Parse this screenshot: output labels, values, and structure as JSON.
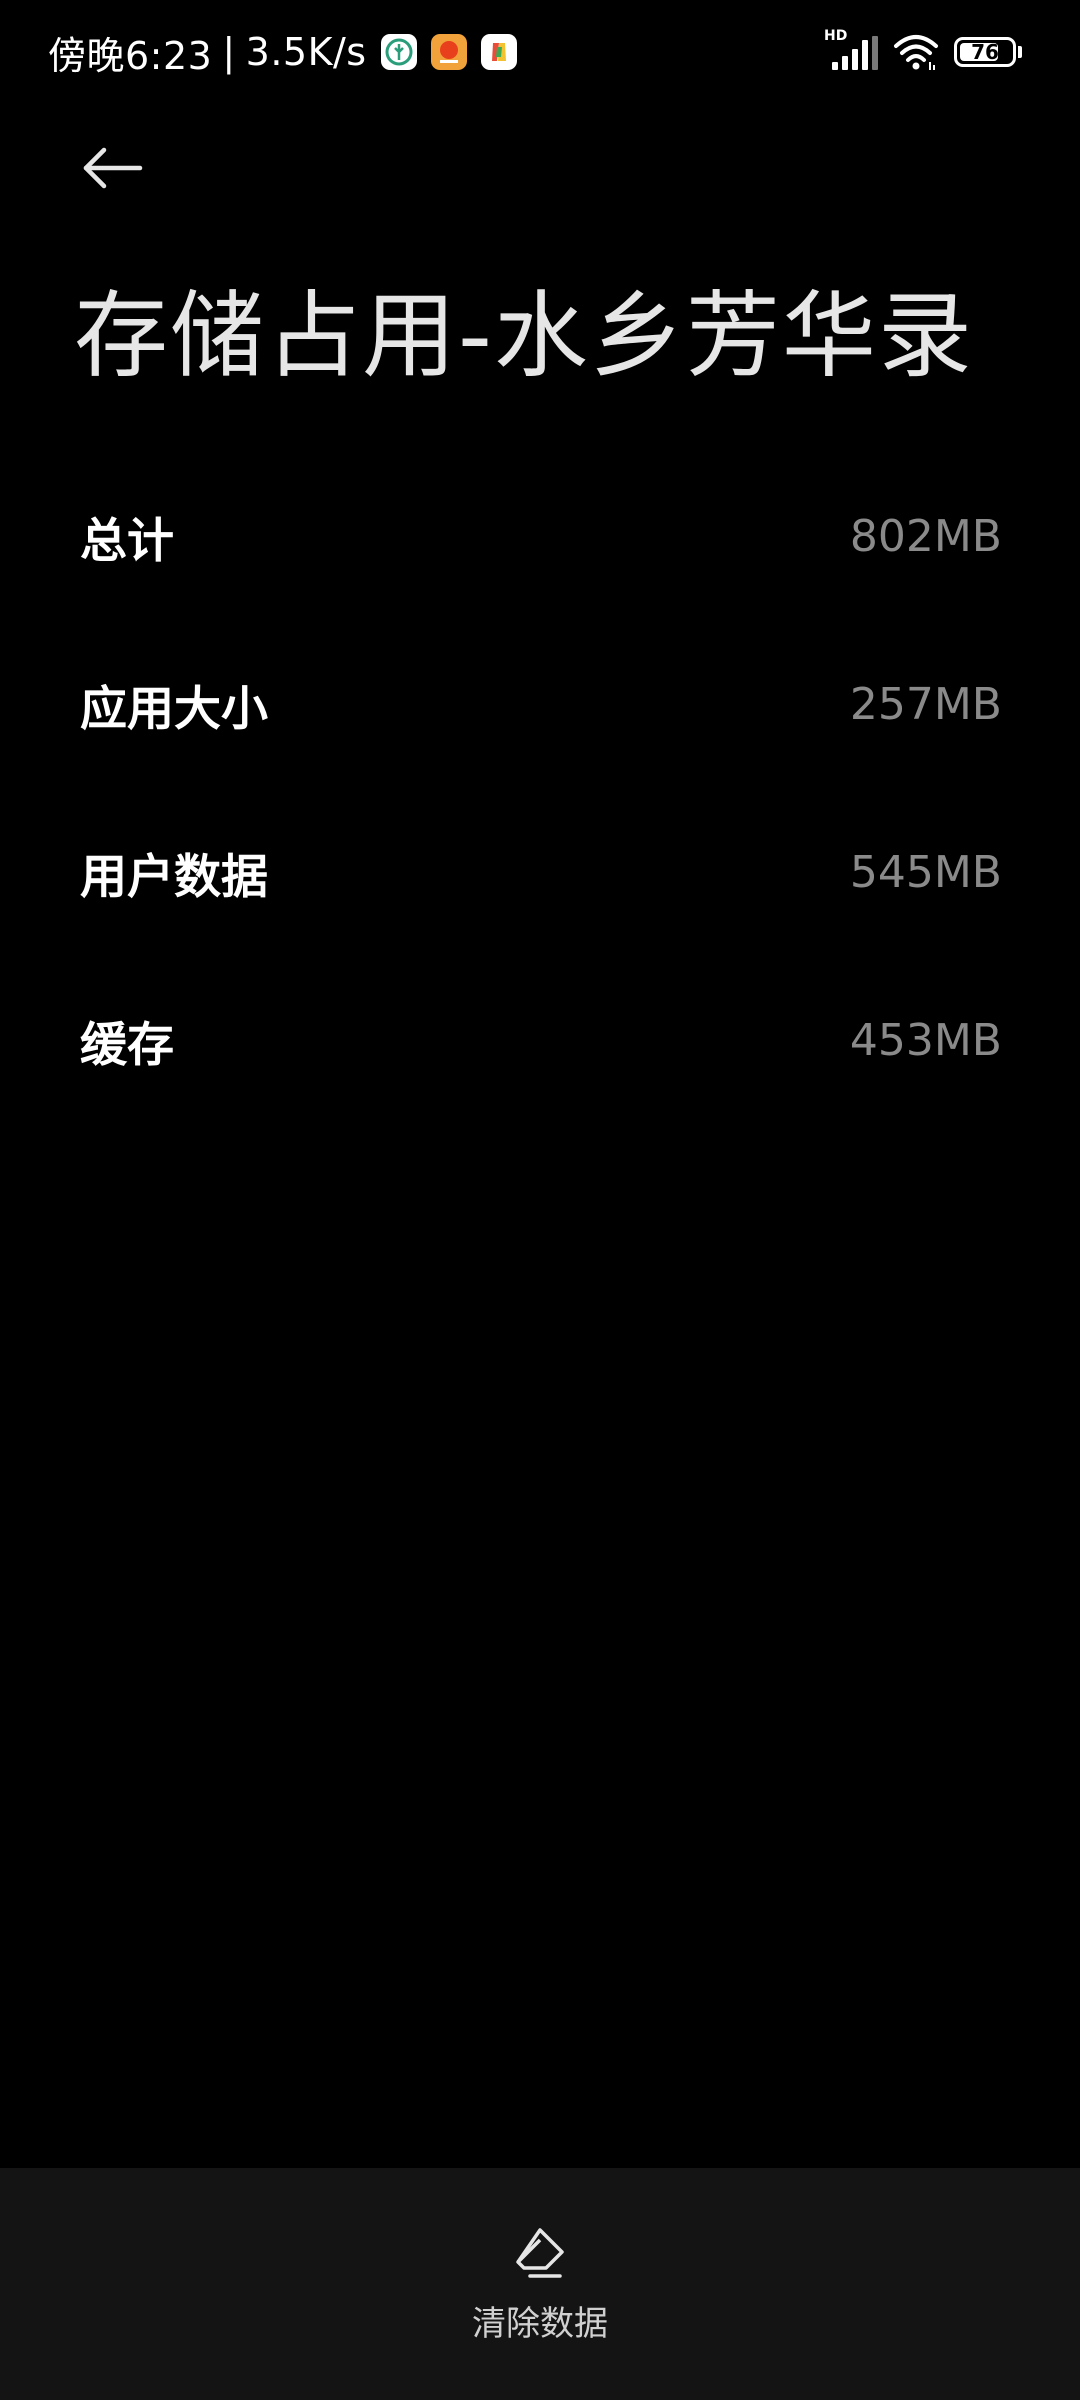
{
  "status_bar": {
    "time": "傍晚6:23",
    "network_speed": "3.5K/s",
    "separator": "|",
    "network_type": "HD",
    "battery_level": "76",
    "battery_percent": 76,
    "icons": [
      "app-notification-icon-1",
      "app-notification-icon-2",
      "app-notification-icon-3",
      "hd-label",
      "signal-icon",
      "wifi-icon",
      "battery-icon"
    ]
  },
  "header": {
    "back_icon": "back-arrow-icon",
    "title": "存储占用-水乡芳华录"
  },
  "storage": {
    "items": [
      {
        "label": "总计",
        "value": "802MB"
      },
      {
        "label": "应用大小",
        "value": "257MB"
      },
      {
        "label": "用户数据",
        "value": "545MB"
      },
      {
        "label": "缓存",
        "value": "453MB"
      }
    ]
  },
  "bottom_bar": {
    "clear_icon": "eraser-icon",
    "clear_label": "清除数据"
  },
  "colors": {
    "background": "#000000",
    "bottom_bar": "#141414",
    "label_text": "#ffffff",
    "value_text": "#8a8a8a"
  }
}
